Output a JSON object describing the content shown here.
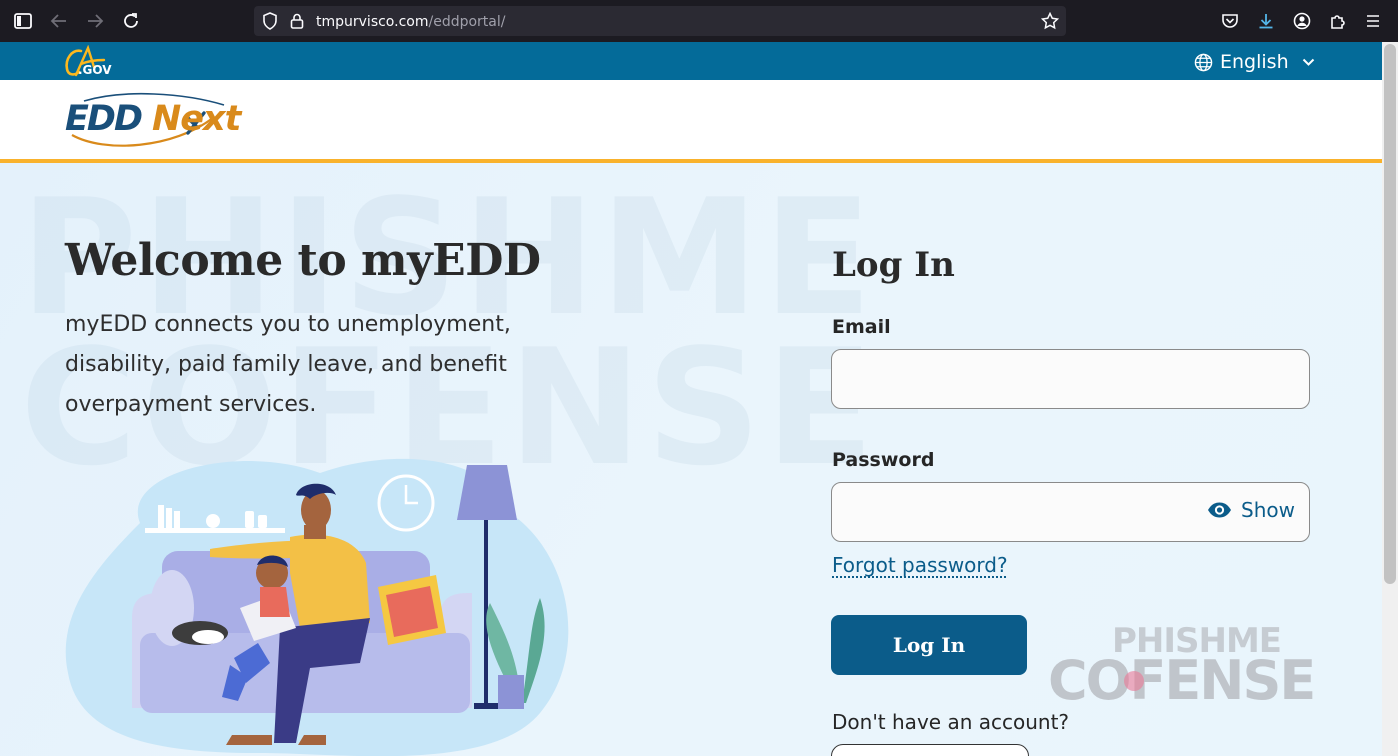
{
  "browser": {
    "url_domain": "tmpurvisco.com",
    "url_path": "/eddportal/"
  },
  "ca_bar": {
    "logo_text": ".GOV",
    "language": "English"
  },
  "header": {
    "logo_text_1": "EDD",
    "logo_text_2": "Next"
  },
  "welcome": {
    "title": "Welcome to myEDD",
    "description": "myEDD connects you to unemployment, disability, paid family leave, and benefit overpayment services."
  },
  "login": {
    "title": "Log In",
    "email_label": "Email",
    "email_value": "",
    "password_label": "Password",
    "password_value": "",
    "show_label": "Show",
    "forgot_label": "Forgot password?",
    "login_button": "Log In",
    "no_account": "Don't have an account?"
  },
  "watermark_overlay": {
    "line1": "PHISHME",
    "line2": "COFENSE"
  },
  "colors": {
    "ca_blue": "#046b99",
    "gold_rule": "#f9b22c",
    "button_blue": "#0b5c8a",
    "logo_navy": "#1a4f7a",
    "logo_orange": "#d98a1b"
  },
  "icons": [
    "sidebar-icon",
    "back-icon",
    "forward-icon",
    "reload-icon",
    "shield-icon",
    "lock-icon",
    "star-icon",
    "pocket-icon",
    "download-icon",
    "account-icon",
    "extensions-icon",
    "menu-icon",
    "globe-icon",
    "chevron-down-icon",
    "eye-icon"
  ]
}
